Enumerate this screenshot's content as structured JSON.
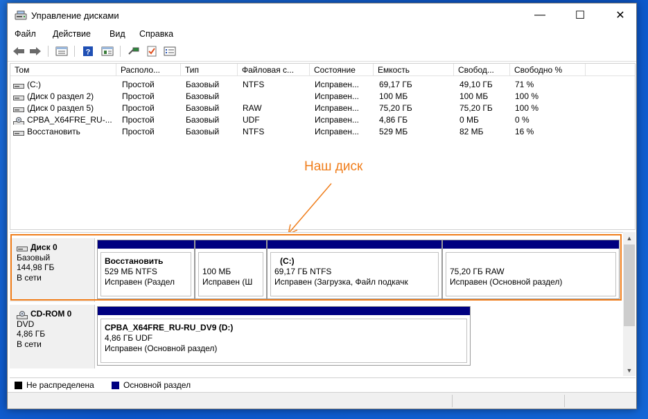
{
  "window": {
    "title": "Управление дисками",
    "icon": "disk-management-icon",
    "controls": {
      "minimize": "—",
      "maximize": "☐",
      "close": "✕"
    }
  },
  "menu": [
    "Файл",
    "Действие",
    "Вид",
    "Справка"
  ],
  "toolbar": {
    "icons": [
      "back-arrow-icon",
      "forward-arrow-icon",
      "list-view-icon",
      "help-icon",
      "properties-icon",
      "connect-icon",
      "check-icon",
      "settings-list-icon"
    ]
  },
  "volume_list": {
    "columns": [
      "Том",
      "Располо...",
      "Тип",
      "Файловая с...",
      "Состояние",
      "Емкость",
      "Свобод...",
      "Свободно %"
    ],
    "rows": [
      {
        "icon": "drive-icon",
        "cells": [
          "(C:)",
          "Простой",
          "Базовый",
          "NTFS",
          "Исправен...",
          "69,17 ГБ",
          "49,10 ГБ",
          "71 %"
        ]
      },
      {
        "icon": "drive-icon",
        "cells": [
          "(Диск 0 раздел 2)",
          "Простой",
          "Базовый",
          "",
          "Исправен...",
          "100 МБ",
          "100 МБ",
          "100 %"
        ]
      },
      {
        "icon": "drive-icon",
        "cells": [
          "(Диск 0 раздел 5)",
          "Простой",
          "Базовый",
          "RAW",
          "Исправен...",
          "75,20 ГБ",
          "75,20 ГБ",
          "100 %"
        ]
      },
      {
        "icon": "cdrom-icon",
        "cells": [
          "CPBA_X64FRE_RU-...",
          "Простой",
          "Базовый",
          "UDF",
          "Исправен...",
          "4,86 ГБ",
          "0 МБ",
          "0 %"
        ]
      },
      {
        "icon": "drive-icon",
        "cells": [
          "Восстановить",
          "Простой",
          "Базовый",
          "NTFS",
          "Исправен...",
          "529 МБ",
          "82 МБ",
          "16 %"
        ]
      }
    ]
  },
  "annotation": {
    "text": "Наш диск",
    "color": "#f07d1a"
  },
  "disks": [
    {
      "name": "Диск 0",
      "icon": "drive-icon",
      "type": "Базовый",
      "size": "144,98 ГБ",
      "status": "В сети",
      "partitions": [
        {
          "title": "Восстановить",
          "size": "529 МБ NTFS",
          "status": "Исправен (Раздел"
        },
        {
          "title": "",
          "size": "100 МБ",
          "status": "Исправен (Ш"
        },
        {
          "title": "(C:)",
          "size": "69,17 ГБ NTFS",
          "status": "Исправен (Загрузка, Файл подкачк"
        },
        {
          "title": "",
          "size": "75,20 ГБ RAW",
          "status": "Исправен (Основной раздел)"
        }
      ]
    },
    {
      "name": "CD-ROM 0",
      "icon": "cdrom-icon",
      "type": "DVD",
      "size": "4,86 ГБ",
      "status": "В сети",
      "partitions": [
        {
          "title": "CPBA_X64FRE_RU-RU_DV9  (D:)",
          "size": "4,86 ГБ UDF",
          "status": "Исправен (Основной раздел)"
        }
      ]
    }
  ],
  "legend": [
    {
      "label": "Не распределена",
      "color": "#000000"
    },
    {
      "label": "Основной раздел",
      "color": "#000080"
    }
  ],
  "colors": {
    "partition_bar": "#000080",
    "highlight": "#f07d1a"
  }
}
